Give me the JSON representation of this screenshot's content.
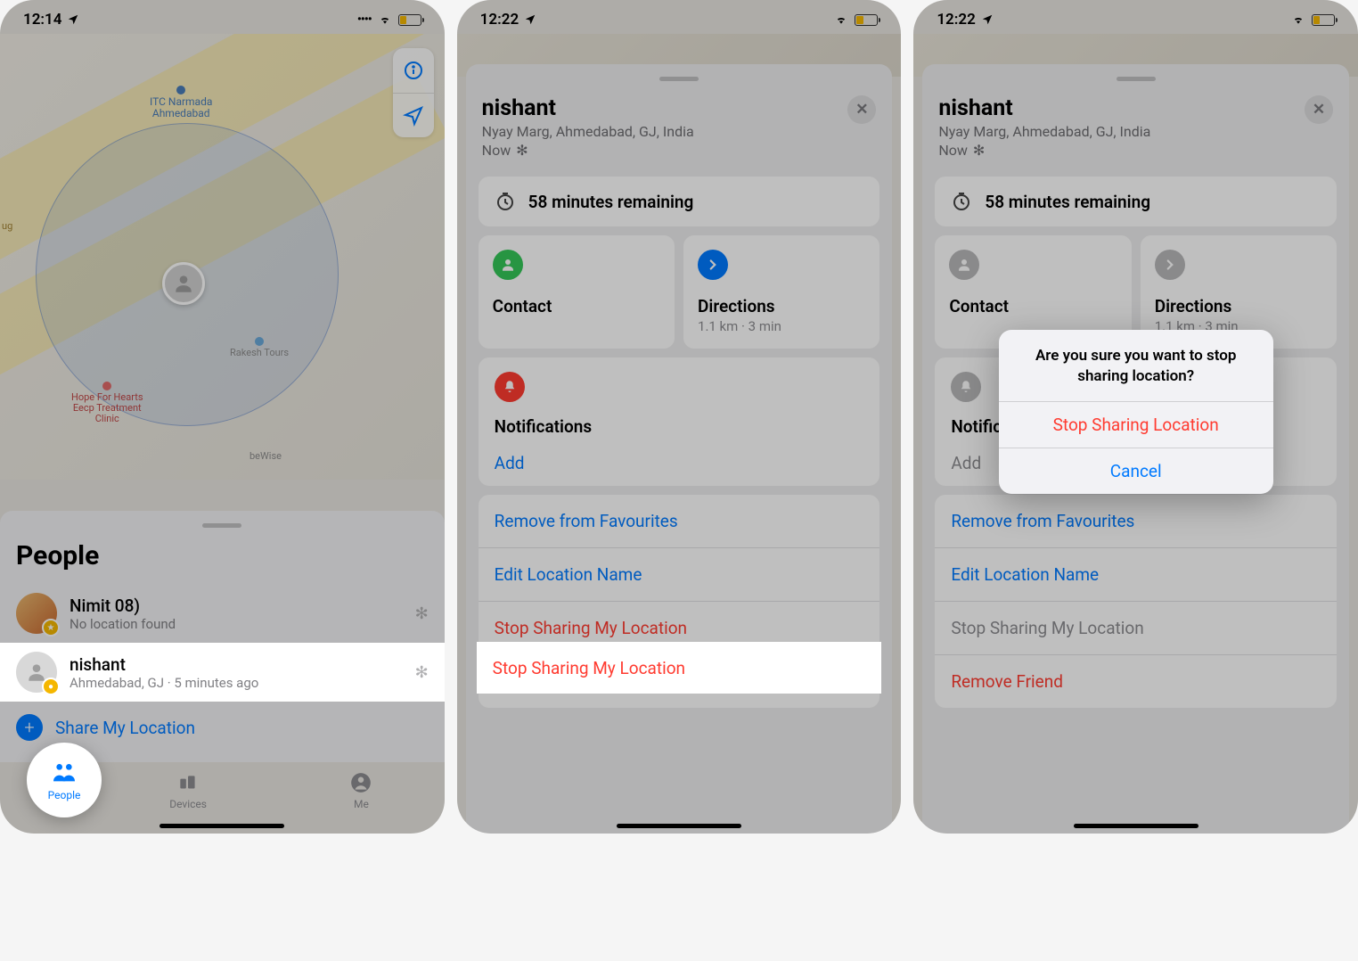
{
  "statusBar": {
    "time1": "12:14",
    "time2": "12:22",
    "time3": "12:22"
  },
  "phone1": {
    "mapLabels": {
      "itc": "ITC Narmada\nAhmedabad",
      "rakesh": "Rakesh Tours",
      "hope": "Hope For Hearts\nEecp Treatment\nClinic",
      "bewise": "beWise",
      "ug": "ug"
    },
    "sheetTitle": "People",
    "people": [
      {
        "name": "Nimit 08)",
        "sub": "No location found"
      },
      {
        "name": "nishant",
        "sub": "Ahmedabad, GJ · 5 minutes ago"
      }
    ],
    "shareLabel": "Share My Location",
    "tabs": {
      "people": "People",
      "devices": "Devices",
      "me": "Me"
    }
  },
  "detail": {
    "name": "nishant",
    "address": "Nyay Marg, Ahmedabad, GJ, India",
    "now": "Now",
    "remaining": "58 minutes remaining",
    "contact": "Contact",
    "directions": "Directions",
    "directionsSub": "1.1 km · 3 min",
    "notifications": "Notifications",
    "add": "Add",
    "removeFav": "Remove from Favourites",
    "editLoc": "Edit Location Name",
    "stopSharing": "Stop Sharing My Location",
    "removeFriend": "Remove Friend"
  },
  "actionSheet": {
    "title": "Are you sure you want to stop sharing location?",
    "stop": "Stop Sharing Location",
    "cancel": "Cancel"
  }
}
